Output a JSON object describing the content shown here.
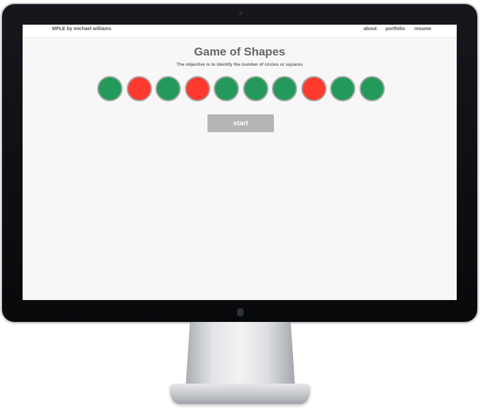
{
  "nav": {
    "brand": "MPLE by michael williams",
    "links": [
      "about",
      "portfolio",
      "resume"
    ]
  },
  "game": {
    "title": "Game of Shapes",
    "subtitle": "The objective is to identify the number of circles or squares",
    "shapes": [
      {
        "type": "circle",
        "color": "#239a5b"
      },
      {
        "type": "circle",
        "color": "#fe3a2f"
      },
      {
        "type": "circle",
        "color": "#239a5b"
      },
      {
        "type": "circle",
        "color": "#fe3a2f"
      },
      {
        "type": "circle",
        "color": "#239a5b"
      },
      {
        "type": "circle",
        "color": "#239a5b"
      },
      {
        "type": "circle",
        "color": "#239a5b"
      },
      {
        "type": "circle",
        "color": "#fe3a2f"
      },
      {
        "type": "circle",
        "color": "#239a5b"
      },
      {
        "type": "circle",
        "color": "#239a5b"
      }
    ],
    "start_label": "start"
  },
  "colors": {
    "green": "#239a5b",
    "red": "#fe3a2f",
    "button": "#b5b5b5",
    "screen_bg": "#f7f7f7"
  }
}
